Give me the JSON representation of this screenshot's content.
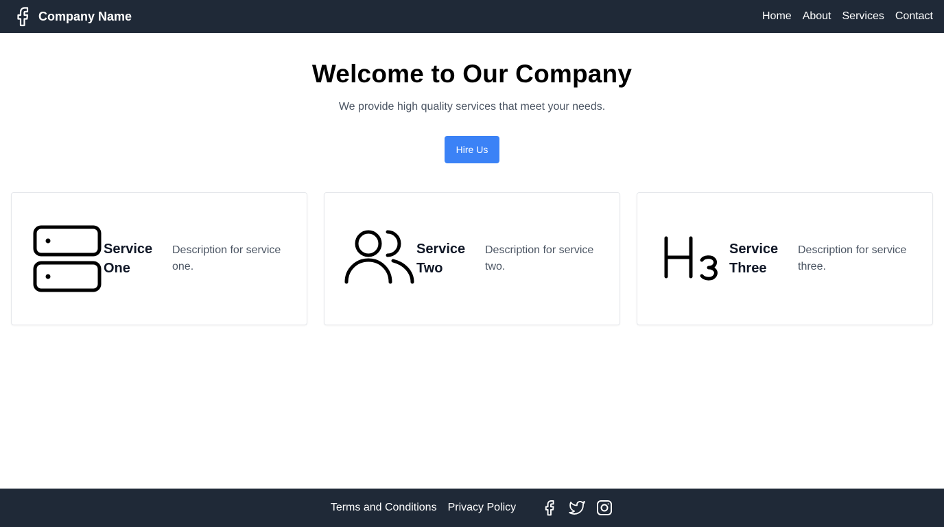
{
  "header": {
    "company_name": "Company Name",
    "logo_icon": "facebook-icon",
    "nav": [
      {
        "label": "Home"
      },
      {
        "label": "About"
      },
      {
        "label": "Services"
      },
      {
        "label": "Contact"
      }
    ]
  },
  "hero": {
    "title": "Welcome to Our Company",
    "subtitle": "We provide high quality services that meet your needs.",
    "cta_label": "Hire Us"
  },
  "services": [
    {
      "icon": "server-icon",
      "title": "Service One",
      "description": "Description for service one."
    },
    {
      "icon": "users-icon",
      "title": "Service Two",
      "description": "Description for service two."
    },
    {
      "icon": "heading-h3-icon",
      "title": "Service Three",
      "description": "Description for service three."
    }
  ],
  "footer": {
    "links": [
      {
        "label": "Terms and Conditions"
      },
      {
        "label": "Privacy Policy"
      }
    ],
    "social": [
      {
        "icon": "facebook-icon"
      },
      {
        "icon": "twitter-icon"
      },
      {
        "icon": "instagram-icon"
      }
    ]
  },
  "colors": {
    "header_bg": "#1f2937",
    "accent": "#3b82f6",
    "text_muted": "#4b5563"
  }
}
